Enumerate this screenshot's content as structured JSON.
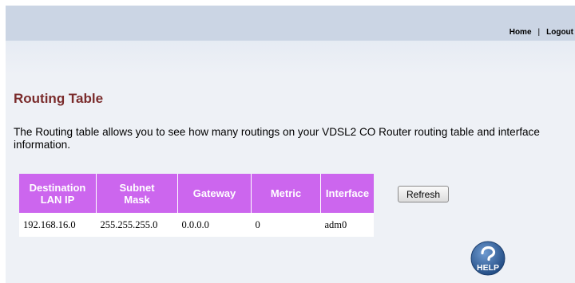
{
  "nav": {
    "home": "Home",
    "separator": "|",
    "logout": "Logout"
  },
  "page": {
    "title": "Routing Table",
    "description": "The Routing table allows you to see how many routings on your VDSL2 CO Router routing table and interface information."
  },
  "table": {
    "headers": {
      "destination_line1": "Destination",
      "destination_line2": "LAN IP",
      "subnet_line1": "Subnet",
      "subnet_line2": "Mask",
      "gateway": "Gateway",
      "metric": "Metric",
      "interface": "Interface"
    },
    "rows": [
      {
        "destination": "192.168.16.0",
        "subnet": "255.255.255.0",
        "gateway": "0.0.0.0",
        "metric": "0",
        "interface": "adm0"
      }
    ]
  },
  "buttons": {
    "refresh": "Refresh",
    "help": "HELP"
  },
  "icons": {
    "help": "help-question-icon"
  },
  "colors": {
    "title": "#7a2b2b",
    "table_header_bg": "#cc66ee",
    "top_bar": "#cbd5e4",
    "help_circle": "#2f5f99"
  }
}
